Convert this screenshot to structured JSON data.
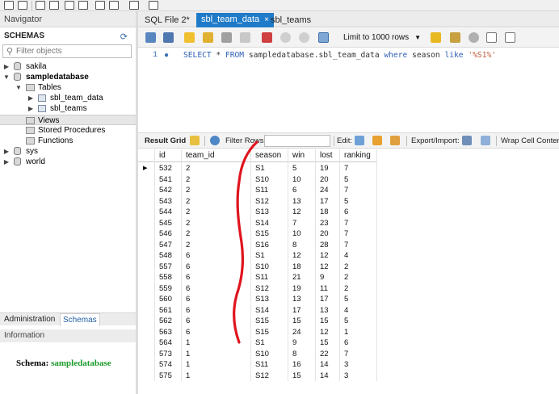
{
  "navigator": {
    "title": "Navigator",
    "schemas_label": "SCHEMAS",
    "filter_placeholder": "Filter objects",
    "tree": [
      {
        "label": "sakila",
        "level": 0,
        "expanded": false,
        "kind": "schema",
        "bold": false
      },
      {
        "label": "sampledatabase",
        "level": 0,
        "expanded": true,
        "kind": "schema",
        "bold": true
      },
      {
        "label": "Tables",
        "level": 1,
        "expanded": true,
        "kind": "folder",
        "bold": false
      },
      {
        "label": "sbl_team_data",
        "level": 2,
        "expanded": false,
        "kind": "table",
        "bold": false
      },
      {
        "label": "sbl_teams",
        "level": 2,
        "expanded": false,
        "kind": "table",
        "bold": false
      },
      {
        "label": "Views",
        "level": 1,
        "expanded": null,
        "kind": "folder",
        "bold": false,
        "selected": true
      },
      {
        "label": "Stored Procedures",
        "level": 1,
        "expanded": null,
        "kind": "folder",
        "bold": false
      },
      {
        "label": "Functions",
        "level": 1,
        "expanded": null,
        "kind": "folder",
        "bold": false
      },
      {
        "label": "sys",
        "level": 0,
        "expanded": false,
        "kind": "schema",
        "bold": false
      },
      {
        "label": "world",
        "level": 0,
        "expanded": false,
        "kind": "schema",
        "bold": false
      }
    ],
    "bottom_tabs": [
      "Administration",
      "Schemas"
    ],
    "information_title": "Information",
    "schema_info_label": "Schema:",
    "schema_info_name": "sampledatabase"
  },
  "editor_tabs": [
    {
      "label": "SQL File 2*",
      "active": false
    },
    {
      "label": "sbl_team_data",
      "active": true
    },
    {
      "label": "sbl_teams",
      "active": false
    }
  ],
  "tab_close": "×",
  "sql_toolbar": {
    "limit_label": "Limit to 1000 rows"
  },
  "query": {
    "line_number": "1",
    "tokens": [
      {
        "t": "SELECT",
        "c": "kw"
      },
      {
        "t": " * ",
        "c": ""
      },
      {
        "t": "FROM",
        "c": "kw"
      },
      {
        "t": " sampledatabase.sbl_team_data ",
        "c": ""
      },
      {
        "t": "where",
        "c": "kw"
      },
      {
        "t": " season ",
        "c": ""
      },
      {
        "t": "like",
        "c": "kw"
      },
      {
        "t": " ",
        "c": ""
      },
      {
        "t": "'%S1%'",
        "c": "str"
      }
    ]
  },
  "result_toolbar": {
    "result_grid": "Result Grid",
    "filter_rows": "Filter Rows:",
    "edit": "Edit:",
    "export_import": "Export/Import:",
    "wrap_cell": "Wrap Cell Contents"
  },
  "grid": {
    "columns": [
      "id",
      "team_id",
      "season",
      "win",
      "lost",
      "ranking"
    ],
    "rows": [
      [
        "532",
        "2",
        "S1",
        "5",
        "19",
        "7"
      ],
      [
        "541",
        "2",
        "S10",
        "10",
        "20",
        "5"
      ],
      [
        "542",
        "2",
        "S11",
        "6",
        "24",
        "7"
      ],
      [
        "543",
        "2",
        "S12",
        "13",
        "17",
        "5"
      ],
      [
        "544",
        "2",
        "S13",
        "12",
        "18",
        "6"
      ],
      [
        "545",
        "2",
        "S14",
        "7",
        "23",
        "7"
      ],
      [
        "546",
        "2",
        "S15",
        "10",
        "20",
        "7"
      ],
      [
        "547",
        "2",
        "S16",
        "8",
        "28",
        "7"
      ],
      [
        "548",
        "6",
        "S1",
        "12",
        "12",
        "4"
      ],
      [
        "557",
        "6",
        "S10",
        "18",
        "12",
        "2"
      ],
      [
        "558",
        "6",
        "S11",
        "21",
        "9",
        "2"
      ],
      [
        "559",
        "6",
        "S12",
        "19",
        "11",
        "2"
      ],
      [
        "560",
        "6",
        "S13",
        "13",
        "17",
        "5"
      ],
      [
        "561",
        "6",
        "S14",
        "17",
        "13",
        "4"
      ],
      [
        "562",
        "6",
        "S15",
        "15",
        "15",
        "5"
      ],
      [
        "563",
        "6",
        "S15",
        "24",
        "12",
        "1"
      ],
      [
        "564",
        "1",
        "S1",
        "9",
        "15",
        "6"
      ],
      [
        "573",
        "1",
        "S10",
        "8",
        "22",
        "7"
      ],
      [
        "574",
        "1",
        "S11",
        "16",
        "14",
        "3"
      ],
      [
        "575",
        "1",
        "S12",
        "15",
        "14",
        "3"
      ]
    ],
    "current_row_marker": "▶"
  },
  "colors": {
    "accent_tab": "#1f7bc8",
    "annotation": "#e0141e",
    "schema_name": "#1a9a2a"
  }
}
